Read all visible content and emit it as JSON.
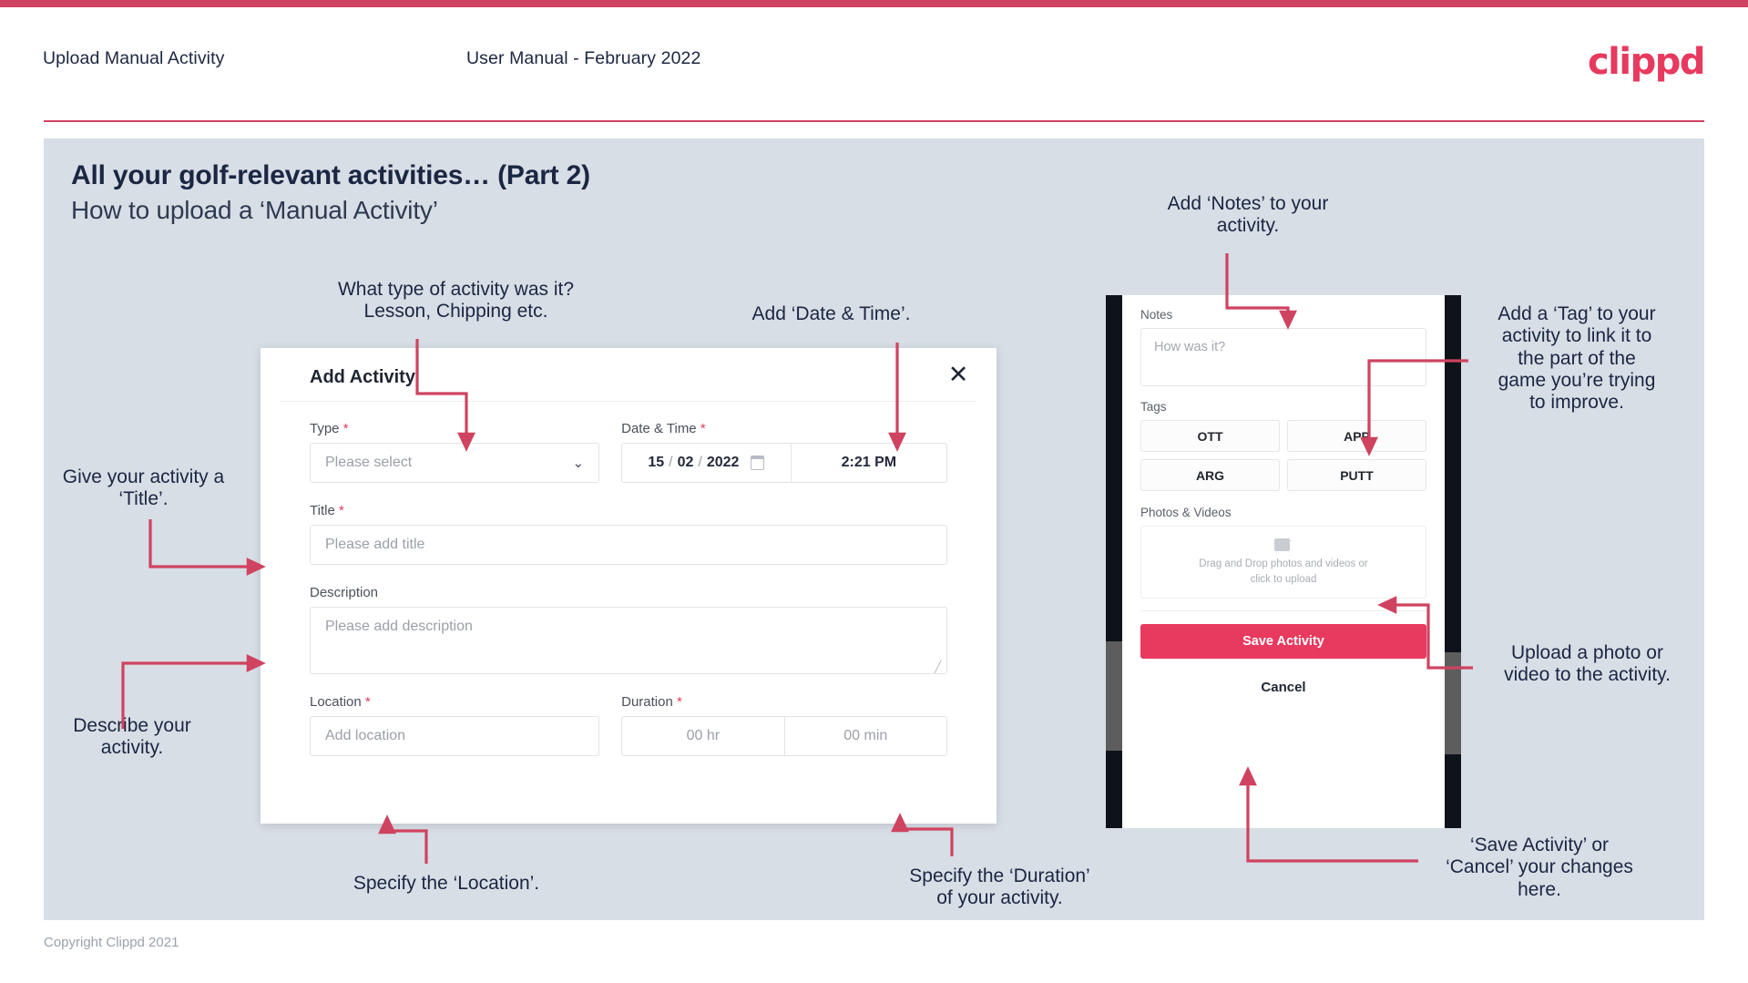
{
  "header": {
    "title": "Upload Manual Activity",
    "subtitle": "User Manual - February 2022",
    "logo": "clippd"
  },
  "slide": {
    "title": "All your golf-relevant activities… (Part 2)",
    "subtitle": "How to upload a ‘Manual Activity’",
    "copyright": "Copyright Clippd 2021"
  },
  "dialog": {
    "title": "Add Activity",
    "close_icon": "close-icon",
    "fields": {
      "type": {
        "label": "Type",
        "required": "*",
        "placeholder": "Please select",
        "chevron": "⌄"
      },
      "datetime": {
        "label": "Date & Time",
        "required": "*",
        "day": "15",
        "sep1": "/",
        "month": "02",
        "sep2": "/",
        "year": "2022",
        "time": "2:21 PM"
      },
      "title": {
        "label": "Title",
        "required": "*",
        "placeholder": "Please add title"
      },
      "description": {
        "label": "Description",
        "placeholder": "Please add description"
      },
      "location": {
        "label": "Location",
        "required": "*",
        "placeholder": "Add location"
      },
      "duration": {
        "label": "Duration",
        "required": "*",
        "hours": "00 hr",
        "minutes": "00 min"
      }
    }
  },
  "phone": {
    "notes": {
      "label": "Notes",
      "placeholder": "How was it?"
    },
    "tags": {
      "label": "Tags",
      "items": [
        "OTT",
        "APP",
        "ARG",
        "PUTT"
      ]
    },
    "photos": {
      "label": "Photos & Videos",
      "upload_line1": "Drag and Drop photos and videos or",
      "upload_line2": "click to upload"
    },
    "save_label": "Save Activity",
    "cancel_label": "Cancel"
  },
  "annotations": {
    "type": "What type of activity was it?\nLesson, Chipping etc.",
    "datetime": "Add ‘Date & Time’.",
    "notes": "Add ‘Notes’ to your\nactivity.",
    "tag": "Add a ‘Tag’ to your\nactivity to link it to\nthe part of the\ngame you’re trying\nto improve.",
    "title": "Give your activity a\n‘Title’.",
    "description": "Describe your\nactivity.",
    "location": "Specify the ‘Location’.",
    "duration": "Specify the ‘Duration’\nof your activity.",
    "upload": "Upload a photo or\nvideo to the activity.",
    "save": "‘Save Activity’ or\n‘Cancel’ your changes\nhere."
  },
  "colors": {
    "brand_pink": "#e8395e",
    "accent_line": "#cf4360",
    "slide_bg": "#d8dee6",
    "text_dark": "#1b2642"
  }
}
